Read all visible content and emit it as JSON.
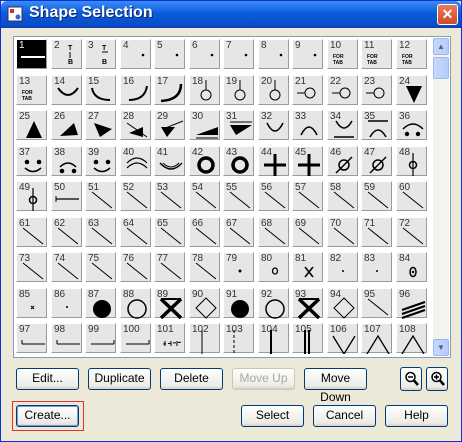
{
  "window": {
    "title": "Shape Selection",
    "title_icon": "shape-app-icon",
    "close_icon": "close-icon"
  },
  "grid": {
    "selected": 1,
    "cells": [
      {
        "n": "1",
        "g": "hline"
      },
      {
        "n": "2",
        "g": "tab",
        "t": "T",
        "b": "B"
      },
      {
        "n": "3",
        "g": "tab2",
        "t": "T",
        "b": "B"
      },
      {
        "n": "4",
        "g": "dot"
      },
      {
        "n": "5",
        "g": "dot"
      },
      {
        "n": "6",
        "g": "dot"
      },
      {
        "n": "7",
        "g": "dot"
      },
      {
        "n": "8",
        "g": "dot"
      },
      {
        "n": "9",
        "g": "dot"
      },
      {
        "n": "10",
        "g": "fortab",
        "ft": "FOR TAB"
      },
      {
        "n": "11",
        "g": "fortab",
        "ft": "FOR TAB"
      },
      {
        "n": "12",
        "g": "fortab",
        "ft": "FOR TAB"
      },
      {
        "n": "13",
        "g": "fortab",
        "ft": "FOR TAB"
      },
      {
        "n": "14",
        "g": "smile"
      },
      {
        "n": "15",
        "g": "arcBL"
      },
      {
        "n": "16",
        "g": "arcBR"
      },
      {
        "n": "17",
        "g": "arcBR2"
      },
      {
        "n": "18",
        "g": "lolli"
      },
      {
        "n": "19",
        "g": "lolli"
      },
      {
        "n": "20",
        "g": "lolli"
      },
      {
        "n": "21",
        "g": "lolliR"
      },
      {
        "n": "22",
        "g": "lolliR"
      },
      {
        "n": "23",
        "g": "lolliR"
      },
      {
        "n": "24",
        "g": "tridown"
      },
      {
        "n": "25",
        "g": "triup"
      },
      {
        "n": "26",
        "g": "tri1"
      },
      {
        "n": "27",
        "g": "tri2"
      },
      {
        "n": "28",
        "g": "triline"
      },
      {
        "n": "29",
        "g": "triline2"
      },
      {
        "n": "30",
        "g": "wedge"
      },
      {
        "n": "31",
        "g": "wedge2"
      },
      {
        "n": "32",
        "g": "cup"
      },
      {
        "n": "33",
        "g": "cap"
      },
      {
        "n": "34",
        "g": "cupline"
      },
      {
        "n": "35",
        "g": "capline"
      },
      {
        "n": "36",
        "g": "dots3"
      },
      {
        "n": "37",
        "g": "face"
      },
      {
        "n": "38",
        "g": "face2"
      },
      {
        "n": "39",
        "g": "face"
      },
      {
        "n": "40",
        "g": "caps"
      },
      {
        "n": "41",
        "g": "smile2"
      },
      {
        "n": "42",
        "g": "ring"
      },
      {
        "n": "43",
        "g": "ring"
      },
      {
        "n": "44",
        "g": "plus"
      },
      {
        "n": "45",
        "g": "plus"
      },
      {
        "n": "46",
        "g": "slashcirc"
      },
      {
        "n": "47",
        "g": "slashcirc"
      },
      {
        "n": "48",
        "g": "vcirc"
      },
      {
        "n": "49",
        "g": "vcirc"
      },
      {
        "n": "50",
        "g": "hline2"
      },
      {
        "n": "51",
        "g": "diag"
      },
      {
        "n": "52",
        "g": "diag"
      },
      {
        "n": "53",
        "g": "diag"
      },
      {
        "n": "54",
        "g": "diag"
      },
      {
        "n": "55",
        "g": "diag"
      },
      {
        "n": "56",
        "g": "diag"
      },
      {
        "n": "57",
        "g": "diag"
      },
      {
        "n": "58",
        "g": "diag"
      },
      {
        "n": "59",
        "g": "diag"
      },
      {
        "n": "60",
        "g": "diag"
      },
      {
        "n": "61",
        "g": "diag"
      },
      {
        "n": "62",
        "g": "diag"
      },
      {
        "n": "63",
        "g": "diag"
      },
      {
        "n": "64",
        "g": "diag"
      },
      {
        "n": "65",
        "g": "diag"
      },
      {
        "n": "66",
        "g": "diag"
      },
      {
        "n": "67",
        "g": "diag"
      },
      {
        "n": "68",
        "g": "diag"
      },
      {
        "n": "69",
        "g": "diag"
      },
      {
        "n": "70",
        "g": "diag"
      },
      {
        "n": "71",
        "g": "diag"
      },
      {
        "n": "72",
        "g": "diag"
      },
      {
        "n": "73",
        "g": "diag"
      },
      {
        "n": "74",
        "g": "diag"
      },
      {
        "n": "75",
        "g": "diag"
      },
      {
        "n": "76",
        "g": "diag"
      },
      {
        "n": "77",
        "g": "diag"
      },
      {
        "n": "78",
        "g": "diag"
      },
      {
        "n": "79",
        "g": "smalldot"
      },
      {
        "n": "80",
        "g": "smallring"
      },
      {
        "n": "81",
        "g": "xmark"
      },
      {
        "n": "82",
        "g": "tiny"
      },
      {
        "n": "83",
        "g": "tiny"
      },
      {
        "n": "84",
        "g": "oval"
      },
      {
        "n": "85",
        "g": "tiny2"
      },
      {
        "n": "86",
        "g": "tiny"
      },
      {
        "n": "87",
        "g": "bigdot"
      },
      {
        "n": "88",
        "g": "bigcirc"
      },
      {
        "n": "89",
        "g": "bigx"
      },
      {
        "n": "90",
        "g": "diamond"
      },
      {
        "n": "91",
        "g": "bigdot"
      },
      {
        "n": "92",
        "g": "bigcirc"
      },
      {
        "n": "93",
        "g": "bigx"
      },
      {
        "n": "94",
        "g": "diamond"
      },
      {
        "n": "95",
        "g": "diag"
      },
      {
        "n": "96",
        "g": "stripes"
      },
      {
        "n": "97",
        "g": "bracket"
      },
      {
        "n": "98",
        "g": "bracket"
      },
      {
        "n": "99",
        "g": "bracket2"
      },
      {
        "n": "100",
        "g": "bracket2"
      },
      {
        "n": "101",
        "g": "dash3"
      },
      {
        "n": "102",
        "g": "vline"
      },
      {
        "n": "103",
        "g": "vdash"
      },
      {
        "n": "104",
        "g": "vline2"
      },
      {
        "n": "105",
        "g": "vline3"
      },
      {
        "n": "106",
        "g": "vee"
      },
      {
        "n": "107",
        "g": "vee2"
      },
      {
        "n": "108",
        "g": "vee2"
      }
    ]
  },
  "toolbar": {
    "edit": "Edit...",
    "duplicate": "Duplicate",
    "delete": "Delete",
    "move_up": "Move Up",
    "move_down": "Move Down",
    "zoom_out_icon": "zoom-out-icon",
    "zoom_in_icon": "zoom-in-icon"
  },
  "footer": {
    "create": "Create...",
    "select": "Select",
    "cancel": "Cancel",
    "help": "Help"
  },
  "colors": {
    "title_bar": "#0B5BDB",
    "window_bg": "#ECE9D8",
    "cell_bg": "#E6E6E6",
    "highlight": "#E03030"
  }
}
